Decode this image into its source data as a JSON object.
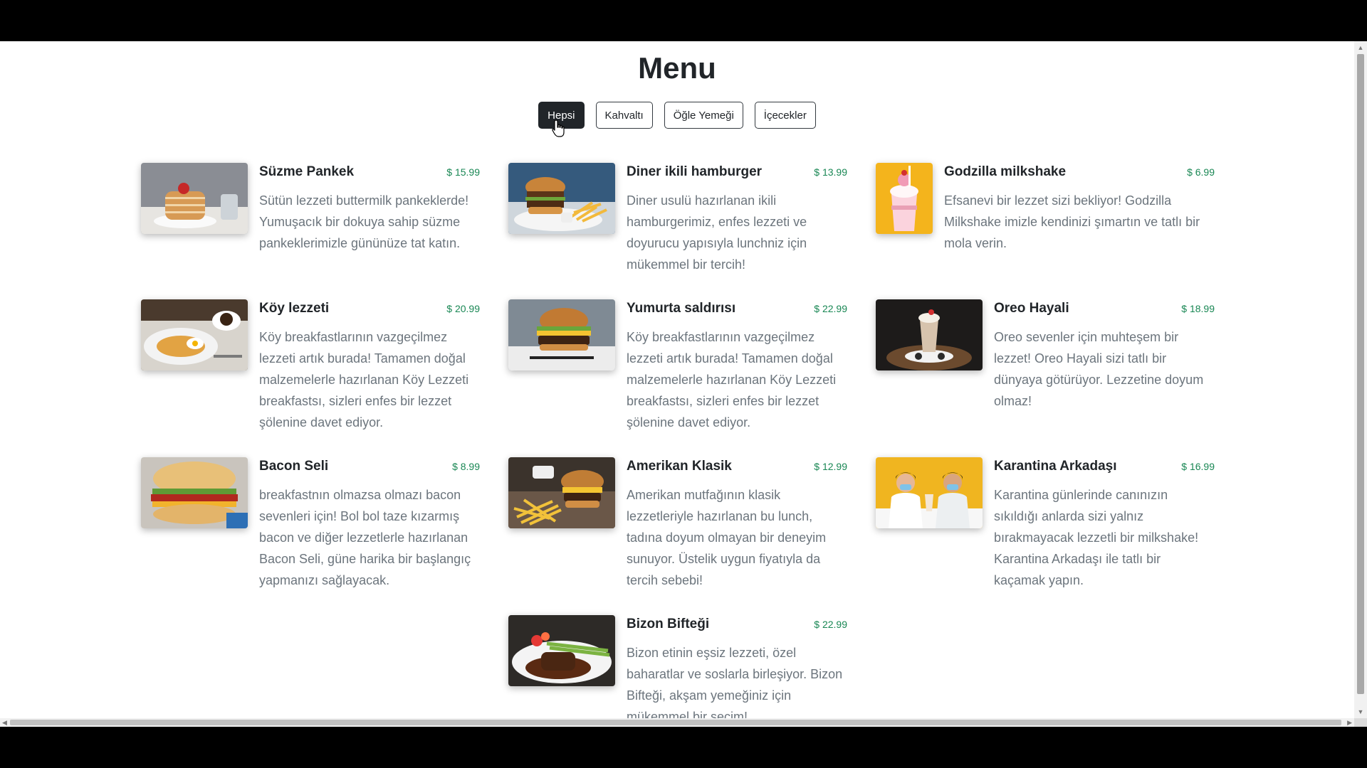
{
  "page": {
    "title": "Menu"
  },
  "filters": [
    {
      "label": "Hepsi",
      "active": true
    },
    {
      "label": "Kahvaltı",
      "active": false
    },
    {
      "label": "Öğle Yemeği",
      "active": false
    },
    {
      "label": "İçecekler",
      "active": false
    }
  ],
  "items": [
    {
      "name": "Süzme Pankek",
      "price": "$ 15.99",
      "desc": "Sütün lezzeti buttermilk pankeklerde! Yumuşacık bir dokuya sahip süzme pankeklerimizle gününüze tat katın.",
      "image": "pancake-photo"
    },
    {
      "name": "Diner ikili hamburger",
      "price": "$ 13.99",
      "desc": "Diner usulü hazırlanan ikili hamburgerimiz, enfes lezzeti ve doyurucu yapısıyla lunchniz için mükemmel bir tercih!",
      "image": "burger-photo"
    },
    {
      "name": "Godzilla milkshake",
      "price": "$ 6.99",
      "desc": "Efsanevi bir lezzet sizi bekliyor! Godzilla Milkshake imizle kendinizi şımartın ve tatlı bir mola verin.",
      "image": "milkshake-photo"
    },
    {
      "name": "Köy lezzeti",
      "price": "$ 20.99",
      "desc": "Köy breakfastlarının vazgeçilmez lezzeti artık burada! Tamamen doğal malzemelerle hazırlanan Köy Lezzeti breakfastsı, sizleri enfes bir lezzet şölenine davet ediyor.",
      "image": "breakfast-photo"
    },
    {
      "name": "Yumurta saldırısı",
      "price": "$ 22.99",
      "desc": "Köy breakfastlarının vazgeçilmez lezzeti artık burada! Tamamen doğal malzemelerle hazırlanan Köy Lezzeti breakfastsı, sizleri enfes bir lezzet şölenine davet ediyor.",
      "image": "egg-burger-photo"
    },
    {
      "name": "Oreo Hayali",
      "price": "$ 18.99",
      "desc": "Oreo sevenler için muhteşem bir lezzet! Oreo Hayali sizi tatlı bir dünyaya götürüyor. Lezzetine doyum olmaz!",
      "image": "oreo-shake-photo"
    },
    {
      "name": "Bacon Seli",
      "price": "$ 8.99",
      "desc": "breakfastnın olmazsa olmazı bacon sevenleri için! Bol bol taze kızarmış bacon ve diğer lezzetlerle hazırlanan Bacon Seli, güne harika bir başlangıç yapmanızı sağlayacak.",
      "image": "bacon-sandwich-photo"
    },
    {
      "name": "Amerikan Klasik",
      "price": "$ 12.99",
      "desc": "Amerikan mutfağının klasik lezzetleriyle hazırlanan bu lunch, tadına doyum olmayan bir deneyim sunuyor. Üstelik uygun fiyatıyla da tercih sebebi!",
      "image": "burger-fries-photo"
    },
    {
      "name": "Karantina Arkadaşı",
      "price": "$ 16.99",
      "desc": "Karantina günlerinde canınızın sıkıldığı anlarda sizi yalnız bırakmayacak lezzetli bir milkshake! Karantina Arkadaşı ile tatlı bir kaçamak yapın.",
      "image": "couple-milkshake-photo"
    },
    {
      "name": "Bizon Bifteği",
      "price": "$ 22.99",
      "desc": "Bizon etinin eşsiz lezzeti, özel baharatlar ve soslarla birleşiyor. Bizon Bifteği, akşam yemeğiniz için mükemmel bir seçim!",
      "image": "steak-photo"
    }
  ]
}
